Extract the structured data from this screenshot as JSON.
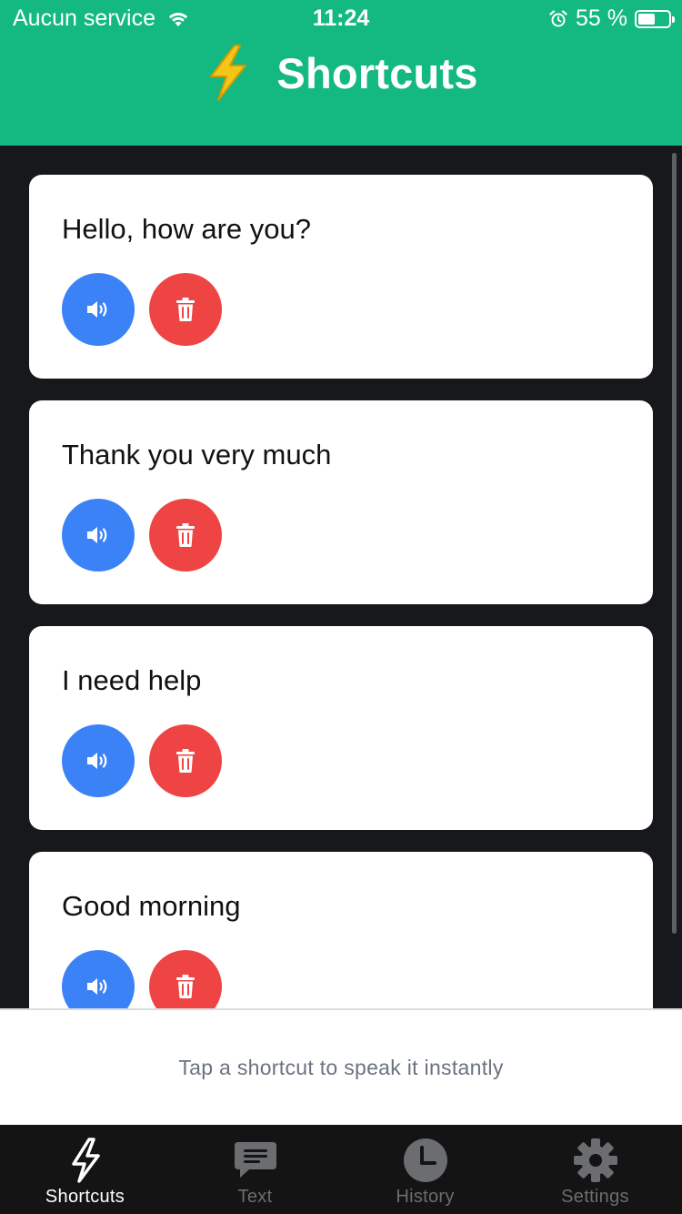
{
  "status_bar": {
    "carrier": "Aucun service",
    "time": "11:24",
    "battery_percent_text": "55 %",
    "battery_level": 0.55
  },
  "header": {
    "emoji_icon": "lightning-bolt-icon",
    "title": "Shortcuts"
  },
  "colors": {
    "header_bg": "#13b981",
    "speak_button": "#3b82f6",
    "delete_button": "#ef4444",
    "list_bg": "#17181b",
    "tabbar_bg": "#141414"
  },
  "shortcuts": [
    {
      "text": "Hello, how are you?"
    },
    {
      "text": "Thank you very much"
    },
    {
      "text": "I need help"
    },
    {
      "text": "Good morning"
    }
  ],
  "hint": "Tap a shortcut to speak it instantly",
  "tabs": [
    {
      "label": "Shortcuts",
      "icon": "lightning-icon",
      "active": true
    },
    {
      "label": "Text",
      "icon": "message-icon",
      "active": false
    },
    {
      "label": "History",
      "icon": "clock-icon",
      "active": false
    },
    {
      "label": "Settings",
      "icon": "gear-icon",
      "active": false
    }
  ]
}
